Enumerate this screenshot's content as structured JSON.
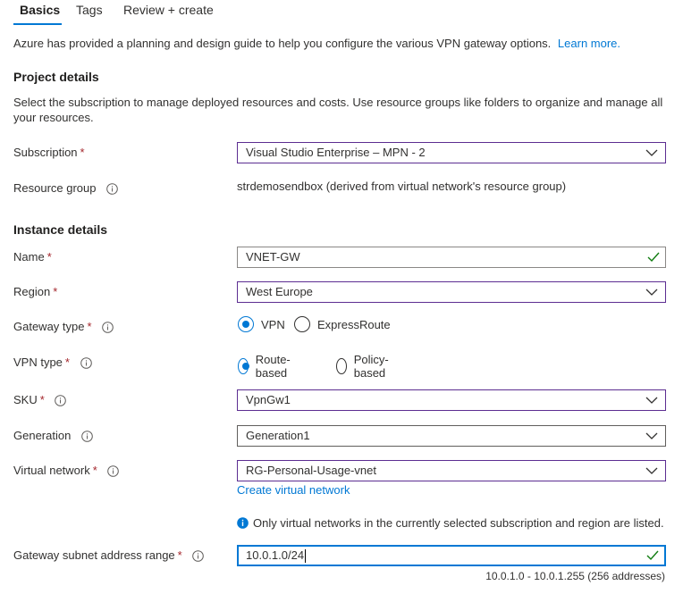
{
  "tabs": [
    {
      "label": "Basics",
      "active": true
    },
    {
      "label": "Tags",
      "active": false
    },
    {
      "label": "Review + create",
      "active": false
    }
  ],
  "intro": {
    "text": "Azure has provided a planning and design guide to help you configure the various VPN gateway options.",
    "link": "Learn more."
  },
  "project": {
    "title": "Project details",
    "description_line1": "Select the subscription to manage deployed resources and costs. Use resource groups like folders to organize and manage all",
    "description_line2": "your resources."
  },
  "fields": {
    "subscription": {
      "label": "Subscription",
      "required": "*",
      "value": "Visual Studio Enterprise – MPN - 2"
    },
    "resource_group": {
      "label": "Resource group",
      "value": "strdemosendbox (derived from virtual network's resource group)"
    },
    "name": {
      "label": "Name",
      "required": "*",
      "value": "VNET-GW"
    },
    "region": {
      "label": "Region",
      "required": "*",
      "value": "West Europe"
    },
    "gateway_type": {
      "label": "Gateway type",
      "required": "*",
      "options": [
        "VPN",
        "ExpressRoute"
      ],
      "selected": "VPN"
    },
    "vpn_type": {
      "label": "VPN type",
      "required": "*",
      "options": [
        "Route-based",
        "Policy-based"
      ],
      "selected": "Route-based"
    },
    "sku": {
      "label": "SKU",
      "required": "*",
      "value": "VpnGw1"
    },
    "generation": {
      "label": "Generation",
      "value": "Generation1"
    },
    "virtual_network": {
      "label": "Virtual network",
      "required": "*",
      "value": "RG-Personal-Usage-vnet",
      "create_link": "Create virtual network"
    },
    "subnet_note": "Only virtual networks in the currently selected subscription and region are listed.",
    "gateway_subnet": {
      "label": "Gateway subnet address range",
      "required": "*",
      "value": "10.0.1.0/24",
      "range_hint": "10.0.1.0 - 10.0.1.255 (256 addresses)"
    }
  },
  "instance": {
    "title": "Instance details"
  },
  "colors": {
    "accent": "#0078d4",
    "border_active": "#5c2d91",
    "required": "#a4262c",
    "valid": "#107c10"
  }
}
